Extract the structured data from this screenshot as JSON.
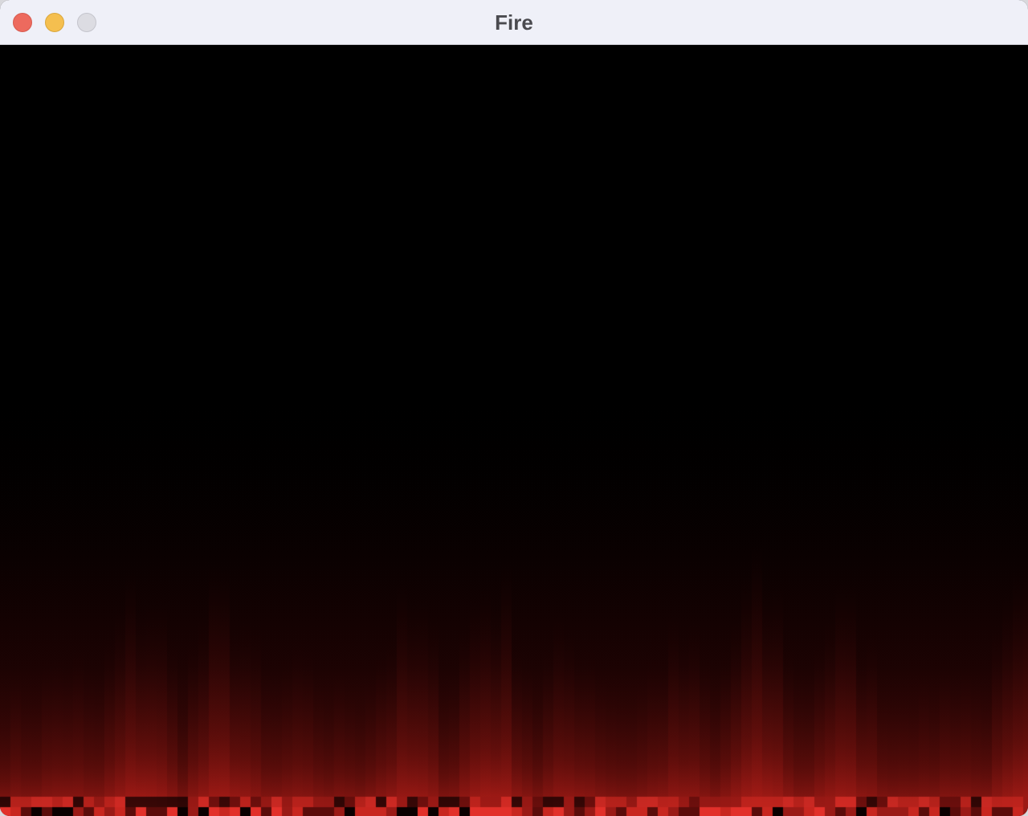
{
  "window": {
    "title": "Fire",
    "controls": {
      "close": "close-button",
      "minimize": "minimize-button",
      "zoom": "zoom-button"
    }
  },
  "canvas": {
    "content": "fire-effect",
    "colors": {
      "background": "#000000",
      "ember_dark": "#3c0606",
      "ember_mid": "#8a1612",
      "ember_bright": "#e2302a"
    }
  }
}
